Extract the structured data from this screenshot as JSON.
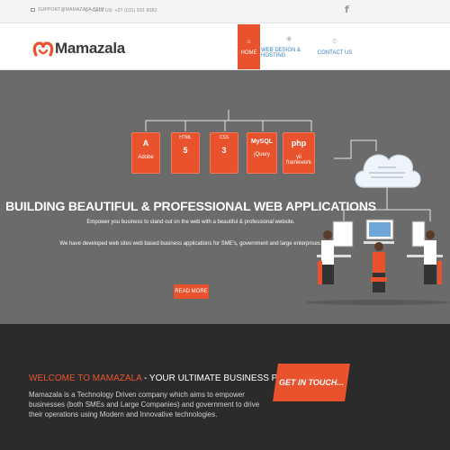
{
  "topbar": {
    "email": "SUPPORT@MAMAZALA.COM",
    "phone": "CALL US: +27 (011) 591 8082",
    "social_icon": "facebook-icon"
  },
  "header": {
    "brand": "Mamazala",
    "nav": [
      {
        "label": "HOME",
        "icon": "home-icon",
        "active": true
      },
      {
        "label": "WEB DESIGN & HOSTING",
        "icon": "globe-icon",
        "active": false
      },
      {
        "label": "CONTACT US",
        "icon": "phone-icon",
        "active": false
      }
    ]
  },
  "hero": {
    "technologies": [
      {
        "glyph": "A",
        "label": "Adobe",
        "sub": ""
      },
      {
        "glyph": "5",
        "label": "HTML",
        "sub": ""
      },
      {
        "glyph": "3",
        "label": "CSS",
        "sub": ""
      },
      {
        "glyph": "MySQL",
        "label": "jQuery",
        "sub": ""
      },
      {
        "glyph": "php",
        "label": "yii framework",
        "sub": ""
      }
    ],
    "title": "BUILDING BEAUTIFUL & PROFESSIONAL WEB APPLICATIONS",
    "line1": "Empower you business to stand out on the web with a beautiful & professional website.",
    "line2": "We have developed web sites web based business applications for SME's, government and large enterprises.",
    "cta": "READ MORE"
  },
  "footer": {
    "welcome_accent": "WELCOME TO MAMAZALA",
    "welcome_rest": " - YOUR ULTIMATE BUSINESS PARTNER",
    "about": "Mamazala is a Technology Driven company which aims to empower businesses (both SMEs and Large Companies) and government to drive their operations using Modern and Innovative technologies.",
    "cta": "GET IN TOUCH..."
  },
  "colors": {
    "accent": "#e8532d",
    "hero_bg": "#6b6b6b",
    "footer_bg": "#2b2b2b",
    "link": "#2f7fc0"
  }
}
